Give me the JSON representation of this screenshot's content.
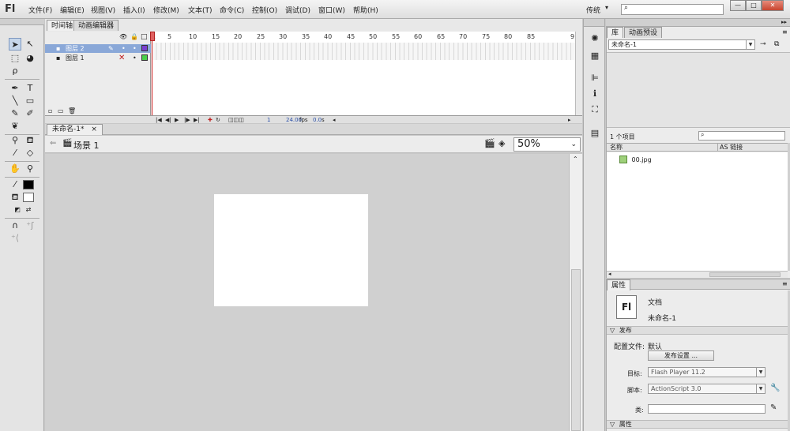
{
  "app": {
    "logo": "Fl",
    "workspace": "传统",
    "workspace_arrow": "▾"
  },
  "menu": [
    "文件(F)",
    "编辑(E)",
    "视图(V)",
    "插入(I)",
    "修改(M)",
    "文本(T)",
    "命令(C)",
    "控制(O)",
    "调试(D)",
    "窗口(W)",
    "帮助(H)"
  ],
  "window_controls": {
    "minimize": "—",
    "maximize": "□",
    "close": "✕"
  },
  "timeline": {
    "tabs": [
      "时间轴",
      "动画编辑器"
    ],
    "layers": [
      {
        "name": "图层 2",
        "selected": true
      },
      {
        "name": "图层 1",
        "selected": false
      }
    ],
    "ruler": [
      "1",
      "5",
      "10",
      "15",
      "20",
      "25",
      "30",
      "35",
      "40",
      "45",
      "50",
      "55",
      "60",
      "65",
      "70",
      "75",
      "80",
      "85",
      "9"
    ],
    "current_frame": "1",
    "fps": "24.00",
    "fps_unit": "fps",
    "time": "0.0",
    "time_unit": "s"
  },
  "document": {
    "tab": "未命名-1*",
    "tab_close": "×",
    "scene": "场景 1",
    "zoom": "50%"
  },
  "library": {
    "tabs": [
      "库",
      "动画预设"
    ],
    "doc_select": "未命名-1",
    "item_count": "1 个项目",
    "col_name": "名称",
    "col_linkage": "AS 链接",
    "items": [
      "00.jpg"
    ]
  },
  "properties": {
    "tab": "属性",
    "doc_type": "文档",
    "doc_name": "未命名-1",
    "publish_header": "发布",
    "profile_label": "配置文件:",
    "profile_value": "默认",
    "publish_settings_btn": "发布设置 ...",
    "target_label": "目标:",
    "target_value": "Flash Player 11.2",
    "script_label": "脚本:",
    "script_value": "ActionScript 3.0",
    "class_label": "类:",
    "props_header": "属性"
  }
}
